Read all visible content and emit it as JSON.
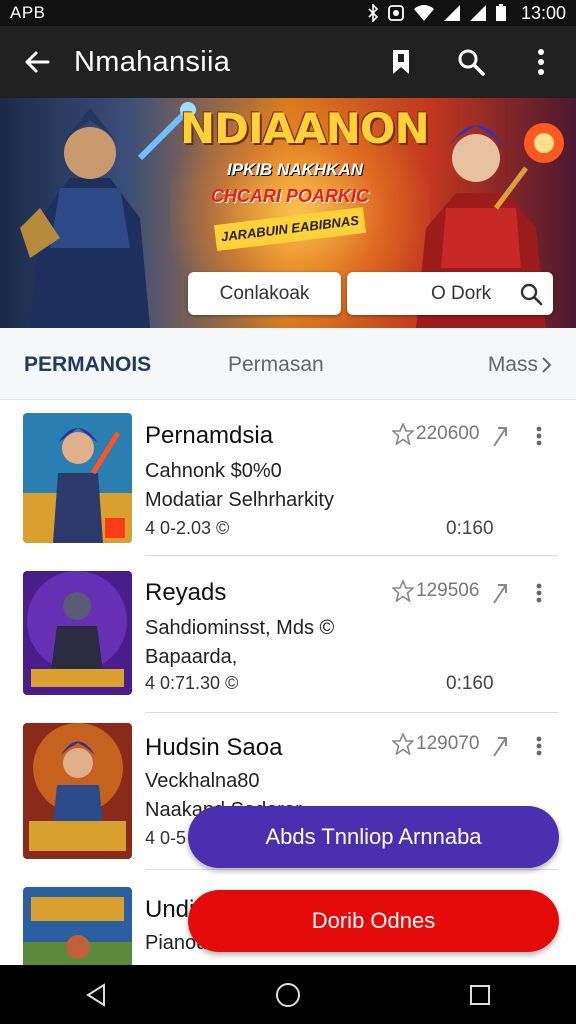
{
  "status_bar": {
    "carrier": "APB",
    "time": "13:00"
  },
  "app_bar": {
    "title": "Nmahansiia",
    "back_icon": "arrow-back-icon",
    "actions": [
      "bookmark-icon",
      "search-icon",
      "more-vert-icon"
    ]
  },
  "banner": {
    "title": "NDIAANON",
    "subtitle_1": "IPKIB NAKHKAN",
    "subtitle_2": "CHCARI POARKIC",
    "tag": "JARABUIN EABIBNAS",
    "button_left": "Conlakoak",
    "button_right": "O Dork"
  },
  "tabs": [
    {
      "label": "PERMANOIS",
      "active": true
    },
    {
      "label": "Permasan",
      "active": false
    },
    {
      "label": "Mass",
      "active": false
    }
  ],
  "items": [
    {
      "name": "Pernamdsia",
      "line1": "Cahnonk $0%0",
      "line2": "Modatiar Selhrharkity",
      "meta": "4 0-2.03 ©",
      "rating": "220600",
      "price": "0:160"
    },
    {
      "name": "Reyads",
      "line1": "Sahdiominsst, Mds ©",
      "line2": "Bapaarda,",
      "meta": "4 0:71.30 ©",
      "rating": "129506",
      "price": "0:160"
    },
    {
      "name": "Hudsin Saoa",
      "line1": "Veckhalna80",
      "line2": "Naakand Sadorar",
      "meta": "4 0-5",
      "rating": "129070",
      "price": ""
    },
    {
      "name": "Undi",
      "line1": "Pianou",
      "line2": "",
      "meta": "",
      "rating": "",
      "price": ""
    }
  ],
  "buttons": {
    "primary": "Abds Tnnliop Arnnaba",
    "secondary": "Dorib Odnes"
  },
  "colors": {
    "app_bar": "#212121",
    "tab_active": "#1f3b5e",
    "fab_primary": "#4a2fb0",
    "fab_secondary": "#e40a0a"
  }
}
